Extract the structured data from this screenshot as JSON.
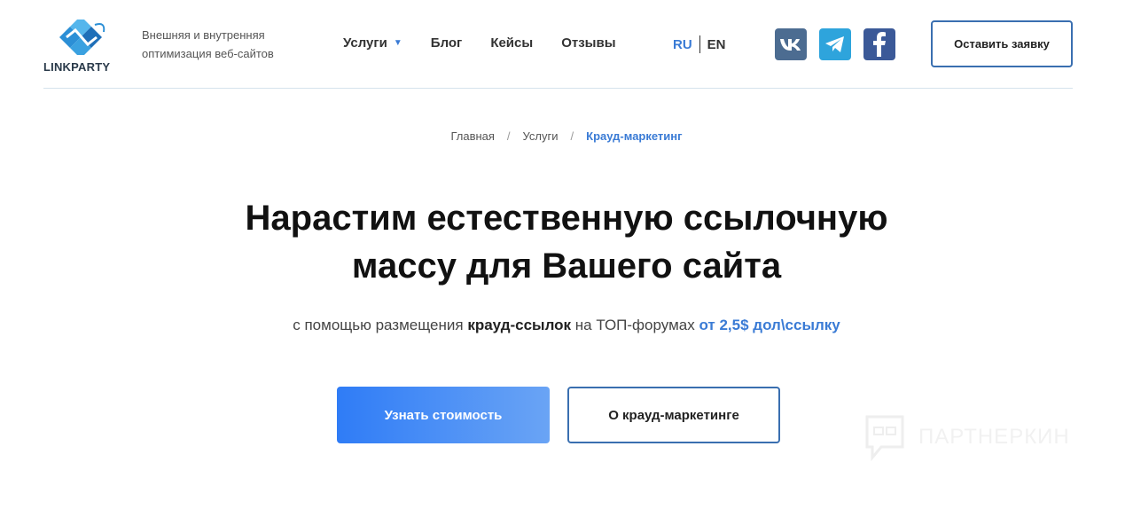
{
  "header": {
    "logo_text": "LINKPARTY",
    "tagline": "Внешняя и внутренняя оптимизация веб-сайтов",
    "nav": [
      {
        "label": "Услуги"
      },
      {
        "label": "Блог"
      },
      {
        "label": "Кейсы"
      },
      {
        "label": "Отзывы"
      }
    ],
    "nav_caret_icon": "caret-down-icon",
    "lang": {
      "ru": "RU",
      "en": "EN",
      "active": "RU"
    },
    "social": [
      {
        "icon": "vk-icon",
        "color": "#4c6c91"
      },
      {
        "icon": "telegram-icon",
        "color": "#2ea4dc"
      },
      {
        "icon": "facebook-icon",
        "color": "#3b5998"
      }
    ],
    "cta_label": "Оставить заявку"
  },
  "breadcrumb": {
    "items": [
      "Главная",
      "Услуги",
      "Крауд-маркетинг"
    ],
    "separator": "/"
  },
  "hero": {
    "title_line1": "Нарастим естественную ссылочную",
    "title_line2": "массу для Вашего сайта",
    "subtitle_part1": "с помощью размещения ",
    "subtitle_bold": "крауд-ссылок",
    "subtitle_part2": " на ТОП-форумах ",
    "subtitle_accent": "от 2,5$ дол\\ссылку",
    "primary_button": "Узнать стоимость",
    "secondary_button": "О крауд-маркетинге"
  },
  "watermark": {
    "text": "ПАРТНЕРКИН",
    "icon": "chat-bubble-icon"
  },
  "colors": {
    "accent": "#3a7bd5",
    "border_blue": "#3a6fb0",
    "button_gradient_start": "#2f7cf6",
    "button_gradient_end": "#6aa4f5"
  }
}
